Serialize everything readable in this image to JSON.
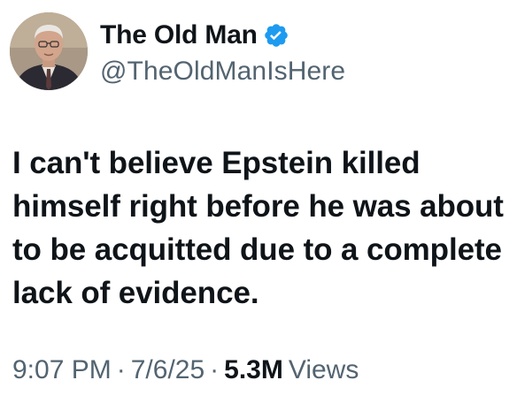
{
  "author": {
    "display_name": "The Old Man",
    "handle": "@TheOldManIsHere",
    "verified_color": "#1d9bf0",
    "avatar_icon": "profile-photo"
  },
  "tweet": {
    "text": "I can't believe Epstein killed himself right before he was about to be acquitted due to a complete lack of evidence."
  },
  "meta": {
    "time": "9:07 PM",
    "separator": "·",
    "date": "7/6/25",
    "views_count": "5.3M",
    "views_label": "Views"
  }
}
